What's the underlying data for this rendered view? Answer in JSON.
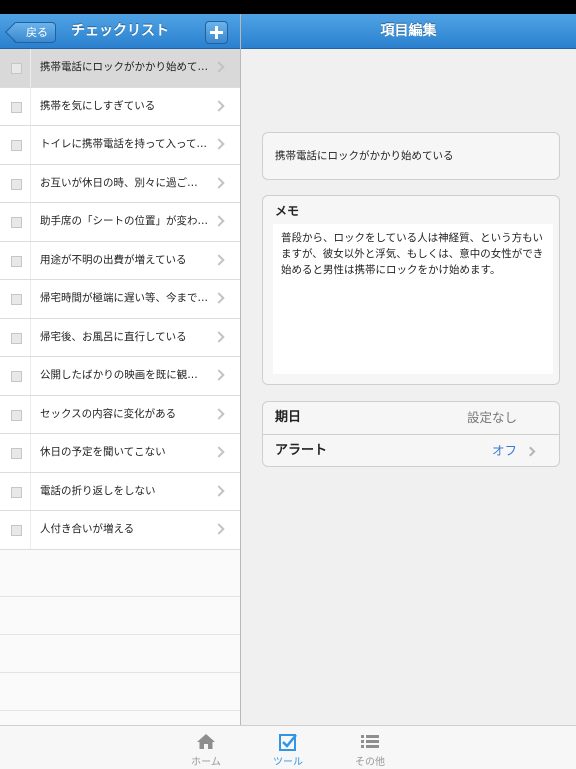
{
  "left_panel": {
    "back_label": "戻る",
    "title": "チェックリスト",
    "items": [
      {
        "label": "携帯電話にロックがかかり始めている",
        "selected": true
      },
      {
        "label": "携帯を気にしすぎている"
      },
      {
        "label": "トイレに携帯電話を持って入っている"
      },
      {
        "label": "お互いが休日の時、別々に過ごす頻…"
      },
      {
        "label": "助手席の「シートの位置」が変わっ…"
      },
      {
        "label": "用途が不明の出費が増えている"
      },
      {
        "label": "帰宅時間が極端に遅い等、今までと…"
      },
      {
        "label": "帰宅後、お風呂に直行している"
      },
      {
        "label": "公開したばかりの映画を既に観ている"
      },
      {
        "label": "セックスの内容に変化がある"
      },
      {
        "label": "休日の予定を聞いてこない"
      },
      {
        "label": "電話の折り返しをしない"
      },
      {
        "label": "人付き合いが増える"
      }
    ]
  },
  "right_panel": {
    "title": "項目編集",
    "item_title": "携帯電話にロックがかかり始めている",
    "memo_label": "メモ",
    "memo_text": "普段から、ロックをしている人は神経質、という方もいますが、彼女以外と浮気、もしくは、意中の女性ができ始めると男性は携帯にロックをかけ始めます。",
    "due_label": "期日",
    "due_value": "設定なし",
    "alert_label": "アラート",
    "alert_value": "オフ"
  },
  "tabbar": {
    "home": "ホーム",
    "tool": "ツール",
    "other": "その他"
  },
  "colors": {
    "nav_blue": "#2b80cf",
    "active_tab": "#3296e6",
    "link_blue": "#3a7bd5"
  },
  "icons": {
    "back": "back-arrow-icon",
    "add": "plus-icon",
    "checkbox": "checkbox-icon",
    "chevron": "chevron-right-icon",
    "home": "home-icon",
    "tool": "checkbox-tool-icon",
    "other": "list-icon"
  }
}
